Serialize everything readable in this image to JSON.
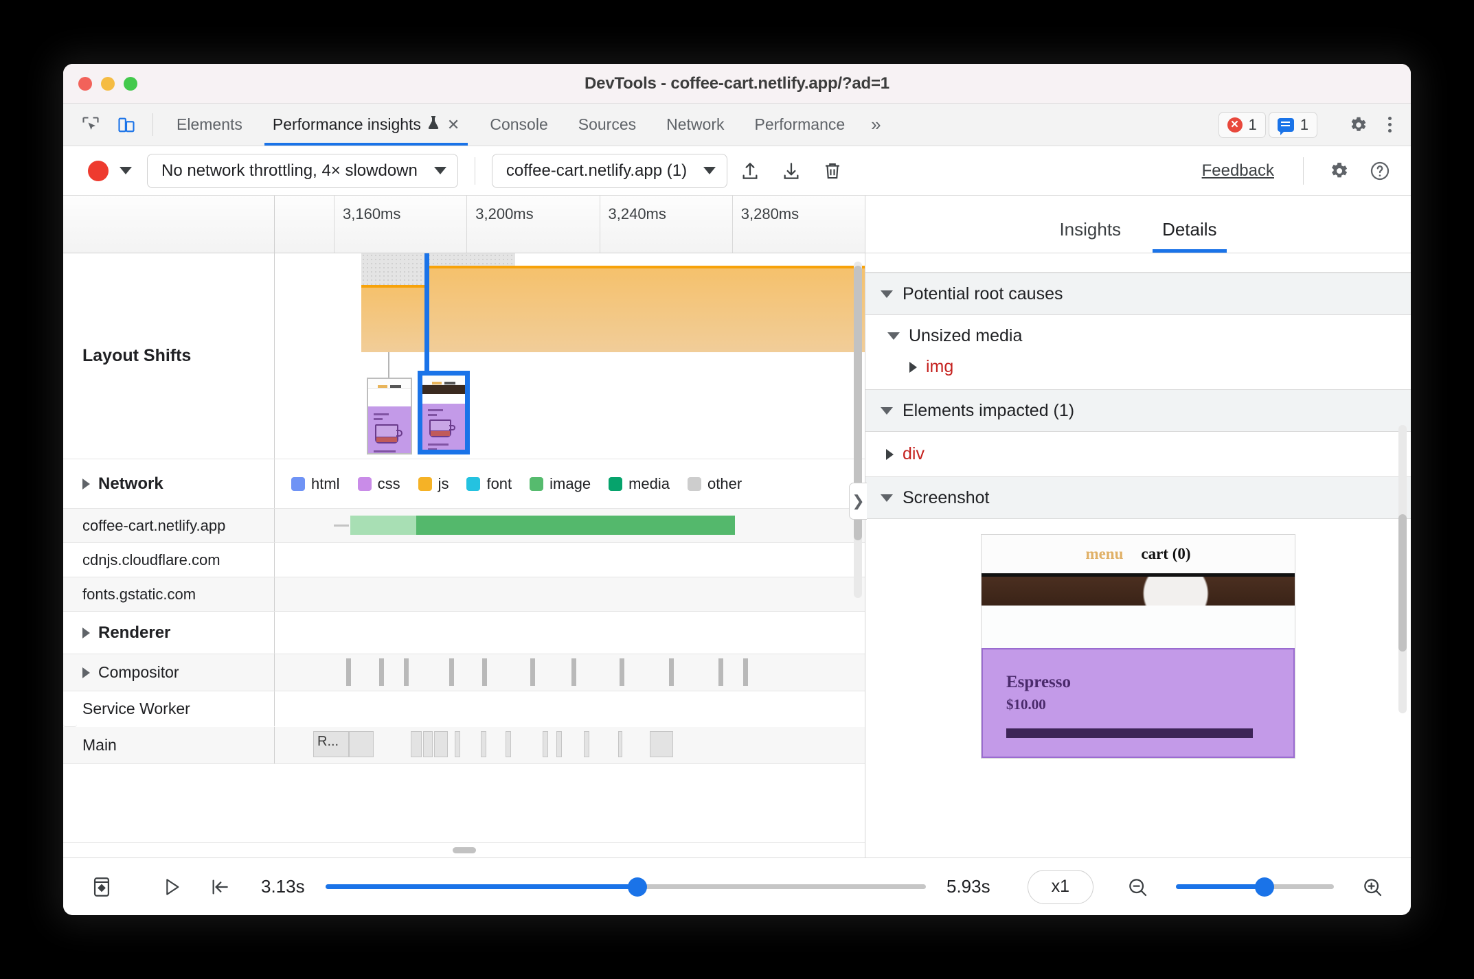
{
  "window": {
    "title": "DevTools - coffee-cart.netlify.app/?ad=1",
    "controls": {
      "close": "close-button",
      "minimize": "minimize-button",
      "zoom": "zoom-button"
    }
  },
  "tabbar": {
    "inspect_icon": "inspect-element-icon",
    "device_icon": "device-toolbar-icon",
    "tabs": [
      {
        "label": "Elements",
        "active": false
      },
      {
        "label": "Performance insights",
        "active": true,
        "beaker": "⚗",
        "closable": true
      },
      {
        "label": "Console",
        "active": false
      },
      {
        "label": "Sources",
        "active": false
      },
      {
        "label": "Network",
        "active": false
      },
      {
        "label": "Performance",
        "active": false
      }
    ],
    "overflow": "»",
    "error_count": "1",
    "message_count": "1",
    "settings_icon": "gear-icon",
    "more_icon": "kebab-menu-icon"
  },
  "toolbar": {
    "record_label": "record-button",
    "throttling": "No network throttling, 4× slowdown",
    "page_select": "coffee-cart.netlify.app (1)",
    "upload_icon": "upload-icon",
    "download_icon": "download-icon",
    "trash_icon": "trash-icon",
    "feedback": "Feedback",
    "settings_icon": "gear-icon",
    "help_icon": "help-icon"
  },
  "timeline": {
    "ticks": [
      "3,160ms",
      "3,200ms",
      "3,240ms",
      "3,280ms"
    ],
    "tracks": {
      "layout_shifts": "Layout Shifts",
      "network": "Network",
      "renderer": "Renderer",
      "compositor": "Compositor",
      "service_worker": "Service Worker",
      "main": "Main",
      "main_block_label": "R..."
    },
    "legend": [
      {
        "label": "html",
        "color": "#6f93f5"
      },
      {
        "label": "css",
        "color": "#c98ce8"
      },
      {
        "label": "js",
        "color": "#f5b226"
      },
      {
        "label": "font",
        "color": "#24c2e0"
      },
      {
        "label": "image",
        "color": "#56bb6e"
      },
      {
        "label": "media",
        "color": "#06a36c"
      },
      {
        "label": "other",
        "color": "#cdcdcd"
      }
    ],
    "network_rows": [
      "coffee-cart.netlify.app",
      "cdnjs.cloudflare.com",
      "fonts.gstatic.com"
    ]
  },
  "details_panel": {
    "tabs": [
      {
        "label": "Insights",
        "active": false
      },
      {
        "label": "Details",
        "active": true
      }
    ],
    "sections": [
      {
        "title": "Potential root causes"
      },
      {
        "title": "Elements impacted (1)"
      },
      {
        "title": "Screenshot"
      }
    ],
    "root_cause_group": "Unsized media",
    "root_cause_element": "img",
    "impacted_element": "div",
    "collapse_icon": "chevron-right-icon",
    "screenshot": {
      "menu": "menu",
      "cart": "cart (0)",
      "product_title": "Espresso",
      "product_price": "$10.00"
    }
  },
  "bottom_bar": {
    "filmstrip_icon": "filmstrip-toggle-icon",
    "play_icon": "play-button",
    "jump_start_icon": "jump-to-start-button",
    "start_time": "3.13s",
    "end_time": "5.93s",
    "speed": "x1",
    "zoom_out_icon": "zoom-out-icon",
    "zoom_in_icon": "zoom-in-icon"
  },
  "colors": {
    "accent": "#1a73e8",
    "shift_orange": "#f7a209",
    "error_red": "#c5221f"
  }
}
